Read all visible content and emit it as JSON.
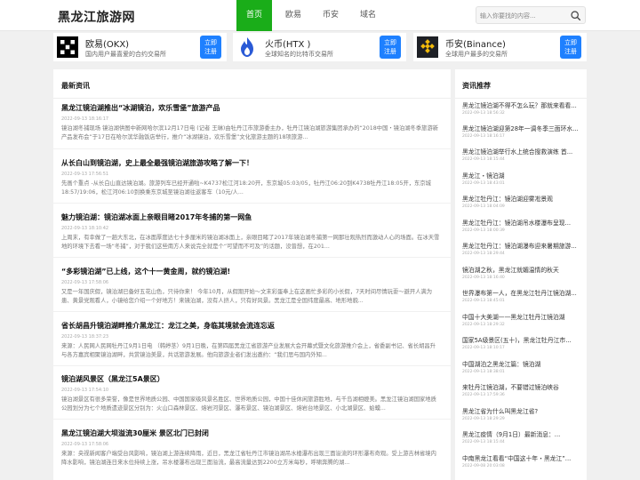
{
  "header": {
    "logo": "黑龙江旅游网",
    "nav": [
      "首页",
      "欧易",
      "币安",
      "域名"
    ],
    "search_placeholder": "输入你要找的内容..."
  },
  "exchanges": [
    {
      "name": "欧易(OKX)",
      "desc": "国内用户最喜爱的合约交易所",
      "btn_line1": "立即",
      "btn_line2": "注册"
    },
    {
      "name": "火币(HTX )",
      "desc": "全球知名的比特币交易所",
      "btn_line1": "立即",
      "btn_line2": "注册"
    },
    {
      "name": "币安(Binance)",
      "desc": "全球用户最多的交易所",
      "btn_line1": "立即",
      "btn_line2": "注册"
    }
  ],
  "main": {
    "title": "最新资讯",
    "articles": [
      {
        "title": "黑龙江镜泊湖推出“冰湖镜泊，欢乐雪堡”旅游产品",
        "time": "2022-09-13 18:16:17",
        "summary": "镜泊湖冬捕现场 镜泊湖供图中新网哈尔滨12月17日电 (记者 王琳)由牡丹江市旅游委主办，牡丹江镜泊湖旅游集团承办的“2018中国・镜泊湖冬季旅游新产品发布会”于17日在哈尔滨华融饭店举行，推介“冰湖镜泊，欢乐雪堡”文化旅游主题的18项旅游..."
      },
      {
        "title": "从长白山到镜泊湖，史上最全最强镜泊湖旅游攻略了解一下！",
        "time": "2022-09-13 17:56:51",
        "summary": "先画个重点 -从长白山直达镜泊湖。旅游列车已经开通啦~K4737松江河18:20开，东京城05:03/05，牡丹江06:20到K4738牡丹江18:05开，东京城18:57/19:06，松江河06:10到换乘东京城至镜泊湖往返客车（10元/人..."
      },
      {
        "title": "魅力镜泊湖：镜泊湖冰面上亲眼目睹2017年冬捕的第一网鱼",
        "time": "2022-09-13 18:10:42",
        "summary": "上周末，有幸做了一趟大东北，在冰面厚度达七十多厘米的镜泊湖冰面上，亲眼目睹了2017年镜泊湖冬捕第一网那壮观热烈而激动人心的场面。在冰天雪地的环境下去看一场“冬捕”，对于我们这些南方人来说完全就是个“可望而不可及”的话题，没曾想，在201..."
      },
      {
        "title": "“多彩镜泊湖”已上线，这个十一黄金周，就约镜泊湖!",
        "time": "2022-09-13 17:58:06",
        "summary": "又是一年国庆假，镜泊湖已备好五花山色，只待你来！ 今年10月，从假期开始～文末彩蛋奉上在这画忙多彩的小长假，7天时间尽情玩耍～避开人满为患、黄景党观看人，小镜给您介绍一个好地方！来镜泊湖，没有人挤人，只有好风景。黑龙江是全国纬度最高、地形地貌..."
      },
      {
        "title": "省长胡昌升镜泊湖畔推介黑龙江：龙江之美，身临其境就会流连忘返",
        "time": "2022-09-13 18:37:23",
        "summary": "来源：人民网人民网牡丹江9月1日电 （韩婷茎）9月1日晚，在第四届黑龙江省旅游产业发展大会开幕式暨文化旅游推介会上，省委副书记、省长胡昌升与各方嘉宾相聚镜泊湖畔，共赏镜泊美景，共话旅游发展。他向旅游业者们发出邀约：“我们思与国内外知..."
      },
      {
        "title": "镜泊湖风景区（黑龙江5A景区）",
        "time": "2022-09-13 17:54:10",
        "summary": "镜泊湖景区有很多荣誉，像是世界地质公园、中国国家级风景名胜区、世界地质公园，中国十佳休闲旅游胜地，与千岛湖相媲美。黑龙江镜泊湖国家地质公园划分为七个地质遗迹景区分别为：火山口森林景区、熔岩河景区、瀑布景区、镜泊湖景区、熔岩台地景区、小北湖景区、蛤蟆..."
      },
      {
        "title": "黑龙江镜泊湖大坝溢流30厘米 景区北门已封闭",
        "time": "2022-09-13 17:58:06",
        "summary": "来源：央视新闻客户端受台风影响，镜泊湖上游连续降雨，近日，黑龙江省牡丹江市镜泊湖吊水楼瀑布出现三面溢流的环形瀑布奇观。受上游吉林省境内降水影响，镜泊湖连日来水位持续上涨，吊水楼瀑布出现三面溢流，最高流量达到2200立方米每秒，呼啸奔腾的湖..."
      }
    ]
  },
  "side": {
    "title": "资讯推荐",
    "items": [
      {
        "title": "黑龙江镜泊湖不得不怎么玩？那就来看看...",
        "time": "2022-09-13 18:56:32"
      },
      {
        "title": "黑龙江镜泊湖迎第28年一调冬季三面环水...",
        "time": "2022-09-13 18:16:17"
      },
      {
        "title": "黑龙江镜泊湖举行水上统合搜救演练 首...",
        "time": "2022-09-13 18:15:44"
      },
      {
        "title": "黑龙江・镜泊湖",
        "time": "2022-09-13 18:43:01"
      },
      {
        "title": "黑龙江牡丹江：镜泊湖迎雾凇景观",
        "time": "2022-09-13 18:04:09"
      },
      {
        "title": "黑龙江牡丹江：镜泊湖吊水楼瀑布呈现...",
        "time": "2022-09-13 18:00:39"
      },
      {
        "title": "黑龙江牡丹江：镜泊湖瀑布迎来暑期旅游...",
        "time": "2022-09-13 18:29:44"
      },
      {
        "title": "镜泊湖之秋，黑龙江就媚温情的秋天",
        "time": "2022-09-13 18:16:40"
      },
      {
        "title": "世界瀑布第一人，在黑龙江牡丹江镜泊湖...",
        "time": "2022-09-13 18:45:01"
      },
      {
        "title": "中国十大美湖——黑龙江牡丹江镜泊湖",
        "time": "2022-09-13 18:29:32"
      },
      {
        "title": "国家5A级景区(五十)，黑龙江牡丹江市...",
        "time": "2022-09-13 18:10:17"
      },
      {
        "title": "中国湖泊之黑龙江篇：镜泊湖",
        "time": "2022-09-13 18:38:01"
      },
      {
        "title": "来牡丹江镜泊湖，不要错过镜泊峡谷",
        "time": "2022-09-13 17:59:36"
      },
      {
        "title": "黑龙江省为什么叫黑龙江省?",
        "time": "2022-09-13 18:29:29"
      },
      {
        "title": "黑龙江疫情（9月1日）最新消息：...",
        "time": "2022-09-13 18:15:44"
      },
      {
        "title": "中南黑龙江看看“中国这十年・黑龙江”...",
        "time": "2022-09-08 20:03:08"
      }
    ]
  },
  "colors": {
    "accent": "#1aad19",
    "button": "#1e80ff"
  },
  "icons": {
    "search": "search-icon",
    "okx": "okx-logo-icon",
    "htx": "htx-logo-icon",
    "binance": "binance-logo-icon"
  }
}
